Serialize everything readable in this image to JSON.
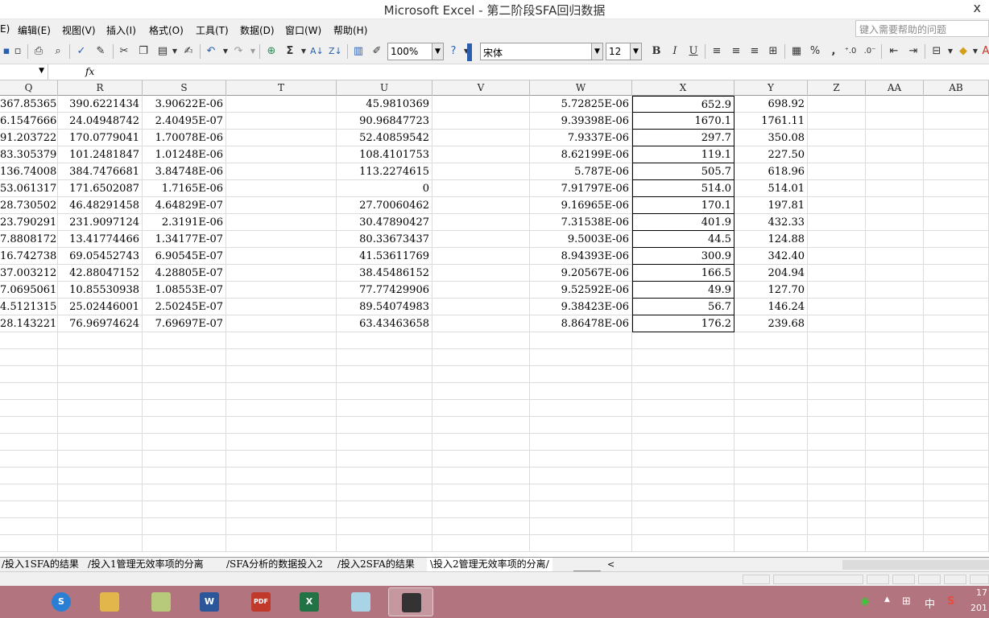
{
  "window": {
    "title": "Microsoft Excel - 第二阶段SFA回归数据",
    "close_glyph": "x"
  },
  "menu": [
    "编辑(E)",
    "视图(V)",
    "插入(I)",
    "格式(O)",
    "工具(T)",
    "数据(D)",
    "窗口(W)",
    "帮助(H)"
  ],
  "menu_partial": "E)",
  "help_box": {
    "placeholder": "键入需要帮助的问题"
  },
  "toolbar": {
    "zoom": "100%",
    "font": "宋体",
    "font_size": "12",
    "bold_label": "B",
    "italic_label": "I",
    "underline_label": "U",
    "percent_label": "%",
    "comma_label": ",",
    "sigma_label": "Σ"
  },
  "formula_bar": {
    "fx": "fx"
  },
  "columns": [
    "Q",
    "R",
    "S",
    "T",
    "U",
    "V",
    "W",
    "X",
    "Y",
    "Z",
    "AA",
    "AB"
  ],
  "rows": [
    [
      "367.85365",
      "390.6221434",
      "3.90622E-06",
      "",
      "45.9810369",
      "",
      "5.72825E-06",
      "652.9",
      "698.92"
    ],
    [
      "6.1547666",
      "24.04948742",
      "2.40495E-07",
      "",
      "90.96847723",
      "",
      "9.39398E-06",
      "1670.1",
      "1761.11"
    ],
    [
      "91.203722",
      "170.0779041",
      "1.70078E-06",
      "",
      "52.40859542",
      "",
      "7.9337E-06",
      "297.7",
      "350.08"
    ],
    [
      "83.305379",
      "101.2481847",
      "1.01248E-06",
      "",
      "108.4101753",
      "",
      "8.62199E-06",
      "119.1",
      "227.50"
    ],
    [
      "136.74008",
      "384.7476681",
      "3.84748E-06",
      "",
      "113.2274615",
      "",
      "5.787E-06",
      "505.7",
      "618.96"
    ],
    [
      "53.061317",
      "171.6502087",
      "1.7165E-06",
      "",
      "0",
      "",
      "7.91797E-06",
      "514.0",
      "514.01"
    ],
    [
      "28.730502",
      "46.48291458",
      "4.64829E-07",
      "",
      "27.70060462",
      "",
      "9.16965E-06",
      "170.1",
      "197.81"
    ],
    [
      "23.790291",
      "231.9097124",
      "2.3191E-06",
      "",
      "30.47890427",
      "",
      "7.31538E-06",
      "401.9",
      "432.33"
    ],
    [
      "7.8808172",
      "13.41774466",
      "1.34177E-07",
      "",
      "80.33673437",
      "",
      "9.5003E-06",
      "44.5",
      "124.88"
    ],
    [
      "16.742738",
      "69.05452743",
      "6.90545E-07",
      "",
      "41.53611769",
      "",
      "8.94393E-06",
      "300.9",
      "342.40"
    ],
    [
      "37.003212",
      "42.88047152",
      "4.28805E-07",
      "",
      "38.45486152",
      "",
      "9.20567E-06",
      "166.5",
      "204.94"
    ],
    [
      "7.0695061",
      "10.85530938",
      "1.08553E-07",
      "",
      "77.77429906",
      "",
      "9.52592E-06",
      "49.9",
      "127.70"
    ],
    [
      "4.5121315",
      "25.02446001",
      "2.50245E-07",
      "",
      "89.54074983",
      "",
      "9.38423E-06",
      "56.7",
      "146.24"
    ],
    [
      "28.143221",
      "76.96974624",
      "7.69697E-07",
      "",
      "63.43463658",
      "",
      "8.86478E-06",
      "176.2",
      "239.68"
    ]
  ],
  "sheet_tabs": [
    "投入1SFA的结果",
    "投入1管理无效率项的分离",
    "SFA分析的数据投入2",
    "投入2SFA的结果",
    "投入2管理无效率项的分离"
  ],
  "taskbar": {
    "apps": [
      "sogou-browser",
      "file-explorer",
      "notes",
      "word",
      "pdf-reader",
      "excel",
      "generic-app",
      "camera-recorder"
    ],
    "tray_ime": "中",
    "clock_time": "17",
    "clock_date": "201"
  }
}
